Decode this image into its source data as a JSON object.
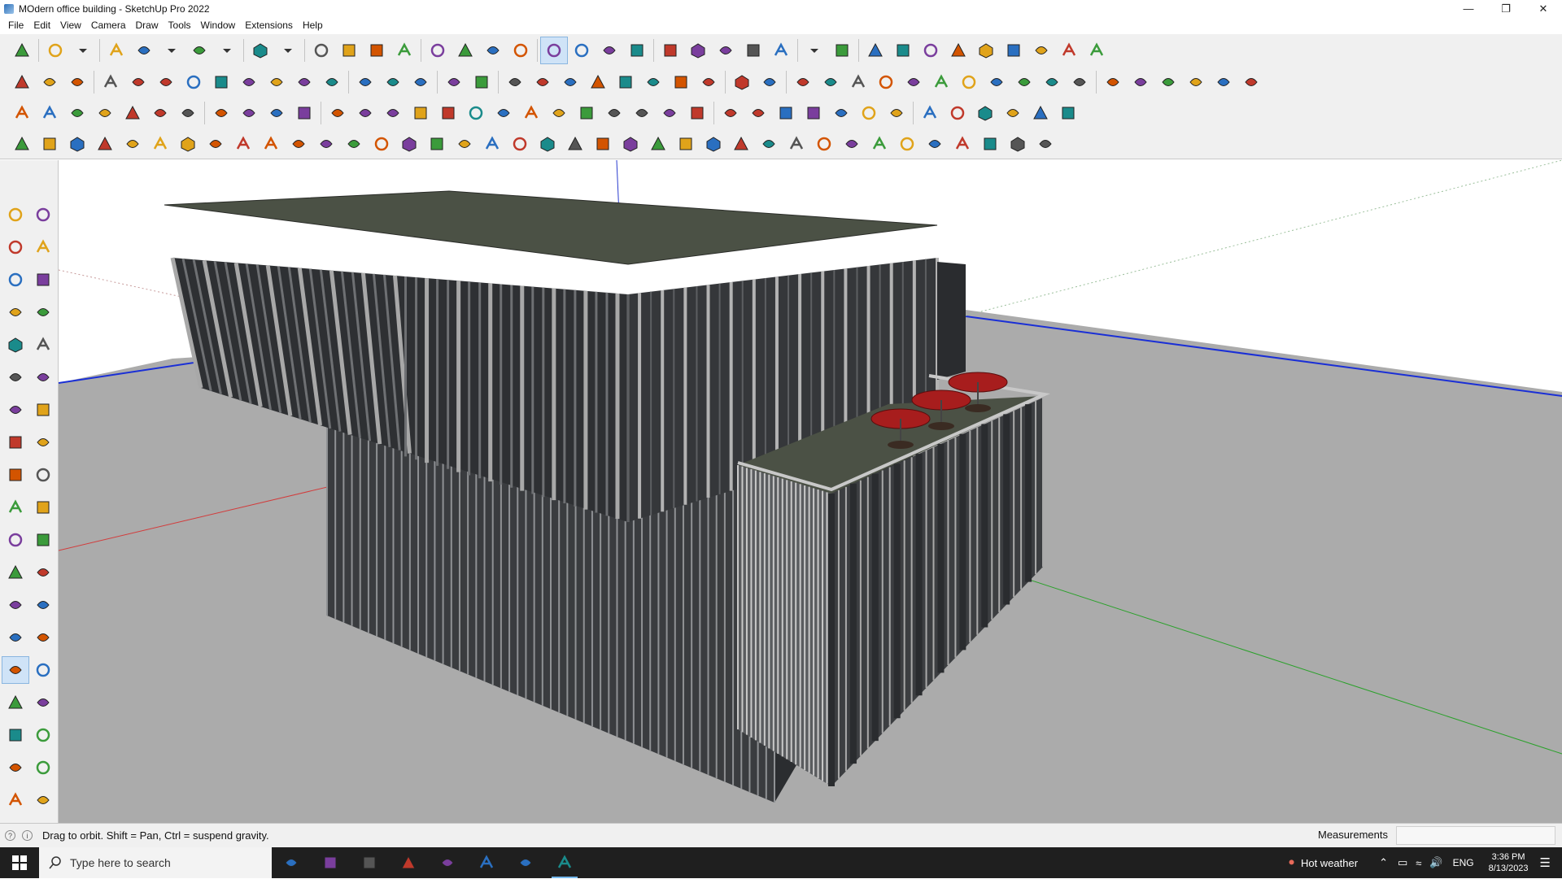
{
  "window": {
    "title": "MOdern office building - SketchUp Pro 2022",
    "minimize": "—",
    "restore": "❐",
    "close": "✕"
  },
  "menu": [
    {
      "label": "File"
    },
    {
      "label": "Edit"
    },
    {
      "label": "View"
    },
    {
      "label": "Camera"
    },
    {
      "label": "Draw"
    },
    {
      "label": "Tools"
    },
    {
      "label": "Window"
    },
    {
      "label": "Extensions"
    },
    {
      "label": "Help"
    }
  ],
  "toolbar_icons": {
    "row1": [
      "zoom-icon",
      "select-icon",
      "select-dropdown-icon",
      "eraser-icon",
      "pencil-icon",
      "pencil-dropdown-icon",
      "freehand-icon",
      "freehand-dropdown-icon",
      "rectangle-icon",
      "rectangle-dropdown-icon",
      "push-pull-icon",
      "follow-me-icon",
      "move-icon",
      "rotate-icon",
      "scale-icon",
      "tape-measure-icon",
      "text-icon",
      "paint-bucket-icon",
      "orbit-icon",
      "pan-icon",
      "zoom-window-icon",
      "zoom-extents-icon",
      "components-icon",
      "styles-icon",
      "layers-icon",
      "outliner-icon",
      "account-icon",
      "account-dropdown-icon",
      "warehouse-icon",
      "extension-warehouse-icon",
      "send-layout-icon",
      "sort-up-icon",
      "sort-down-icon",
      "measure-angle-icon",
      "section-icon",
      "undo-icon",
      "redo-icon",
      "help-hand-icon"
    ],
    "row2": [
      "box-yellow-icon",
      "box-blue-icon",
      "box-mixed-icon",
      "stack-icon",
      "arrow-plus-icon",
      "arrow-blue-icon",
      "arrow-red-icon",
      "arrow-green-icon",
      "arrow-n-icon",
      "arrow-x-icon",
      "arrow-f-icon",
      "curve-icon",
      "wall-blue-icon",
      "wall-dual-icon",
      "wall-ortho-icon",
      "plane-green-icon",
      "plane-star-icon",
      "house-shade-icon",
      "door-icon",
      "house-outline-icon",
      "house-roof-icon",
      "house-filled-icon",
      "garage-icon",
      "fence-icon",
      "leaf-icon",
      "ruler-icon",
      "shape-1-icon",
      "shape-2-icon",
      "shape-3-icon",
      "shape-4-icon",
      "shape-5-icon",
      "shape-6-icon",
      "shape-7-icon",
      "shape-8-icon",
      "shape-9-icon",
      "shape-10-icon",
      "eraser-pink-icon",
      "roof-1-icon",
      "roof-2-icon",
      "roof-3-icon",
      "roof-4-icon",
      "roof-5-icon",
      "roof-6-icon",
      "roof-7-icon"
    ],
    "row3": [
      "blue-plane-icon",
      "blue-slab-icon",
      "yellow-slab-icon",
      "green-slab-icon",
      "red-slab-icon",
      "white-slab-icon",
      "rotate-orange-icon",
      "red-square-icon",
      "shelf-icon",
      "frame-icon",
      "furniture-icon",
      "spiral-icon",
      "stairs-icon",
      "dots-icon",
      "cross-red-icon",
      "cross-green-icon",
      "cross-blue-icon",
      "plane-teal-icon",
      "bulb-icon",
      "warning-icon",
      "hook-icon",
      "hook-orange-icon",
      "knot-icon",
      "pin-blue-icon",
      "box-stack-icon",
      "magnet-red-icon",
      "tree-icon",
      "chair-icon",
      "door-red-icon",
      "cube-icon",
      "stack-red-icon",
      "tool-a-icon",
      "tool-b-icon",
      "tool-c-icon",
      "tool-d-icon",
      "scale-small-icon",
      "arc-dots-icon",
      "grid-tool-icon"
    ],
    "row4": [
      "curve-a-icon",
      "curve-b-icon",
      "curve-c-icon",
      "curve-d-icon",
      "sun-icon",
      "bubble-icon",
      "screw-icon",
      "chain-icon",
      "helix-icon",
      "staple-icon",
      "corner-a-icon",
      "corner-b-icon",
      "corner-c-icon",
      "wave-icon",
      "frame-b-icon",
      "cone-icon",
      "stack-a-icon",
      "stack-b-icon",
      "stack-c-icon",
      "stack-d-icon",
      "stack-e-icon",
      "stack-f-icon",
      "stack-g-icon",
      "stack-h-icon",
      "stack-i-icon",
      "stack-j-icon",
      "stack-k-icon",
      "stack-l-icon",
      "stack-m-icon",
      "stack-n-icon",
      "stack-o-icon",
      "stack-p-icon",
      "stack-q-icon",
      "stack-r-icon",
      "stack-s-icon",
      "stack-t-icon",
      "stack-u-icon",
      "box-outline-icon"
    ]
  },
  "left_tools": [
    [
      "select-icon",
      "orbit-icon"
    ],
    [
      "paint-icon",
      "eraser-icon"
    ],
    [
      "component-icon",
      "tape-icon"
    ],
    [
      "line-icon",
      "freehand-icon"
    ],
    [
      "rectangle-icon",
      "rotated-rect-icon"
    ],
    [
      "circle-icon",
      "polygon-icon"
    ],
    [
      "arc-icon",
      "two-point-arc-icon"
    ],
    [
      "three-point-arc-icon",
      "pie-icon"
    ],
    [
      "move-icon",
      "push-pull-icon"
    ],
    [
      "rotate-icon",
      "follow-me-icon"
    ],
    [
      "scale-icon",
      "offset-icon"
    ],
    [
      "tape-measure-icon",
      "dimension-icon"
    ],
    [
      "protractor-icon",
      "text-icon"
    ],
    [
      "axes-icon",
      "3d-text-icon"
    ],
    [
      "orbit-active-icon",
      "pan-icon"
    ],
    [
      "zoom-icon",
      "zoom-window-icon"
    ],
    [
      "zoom-extents-icon",
      "previous-view-icon"
    ],
    [
      "position-camera-icon",
      "look-around-icon"
    ],
    [
      "walk-icon",
      "section-plane-icon"
    ],
    [
      "components-panel-icon",
      "styles-panel-icon"
    ],
    [
      "layers-panel-icon",
      "outliner-panel-icon"
    ]
  ],
  "status": {
    "hint": "Drag to orbit. Shift = Pan, Ctrl = suspend gravity.",
    "measurements_label": "Measurements",
    "measurements_value": ""
  },
  "taskbar": {
    "search_placeholder": "Type here to search",
    "apps": [
      "task-view-icon",
      "calculator-icon",
      "file-explorer-icon",
      "acrobat-icon",
      "3dsmax-icon",
      "edge-icon",
      "sticky-notes-icon",
      "sketchup-icon"
    ],
    "weather": "Hot weather",
    "lang": "ENG",
    "time": "3:36 PM",
    "date": "8/13/2023"
  },
  "colors": {
    "accent": "#cfe3f7",
    "roof": "#4b5145",
    "facade_dark": "#2e3033",
    "fins": "#9a9a9a",
    "ground": "#ababab",
    "umbrella": "#a71d1d"
  }
}
